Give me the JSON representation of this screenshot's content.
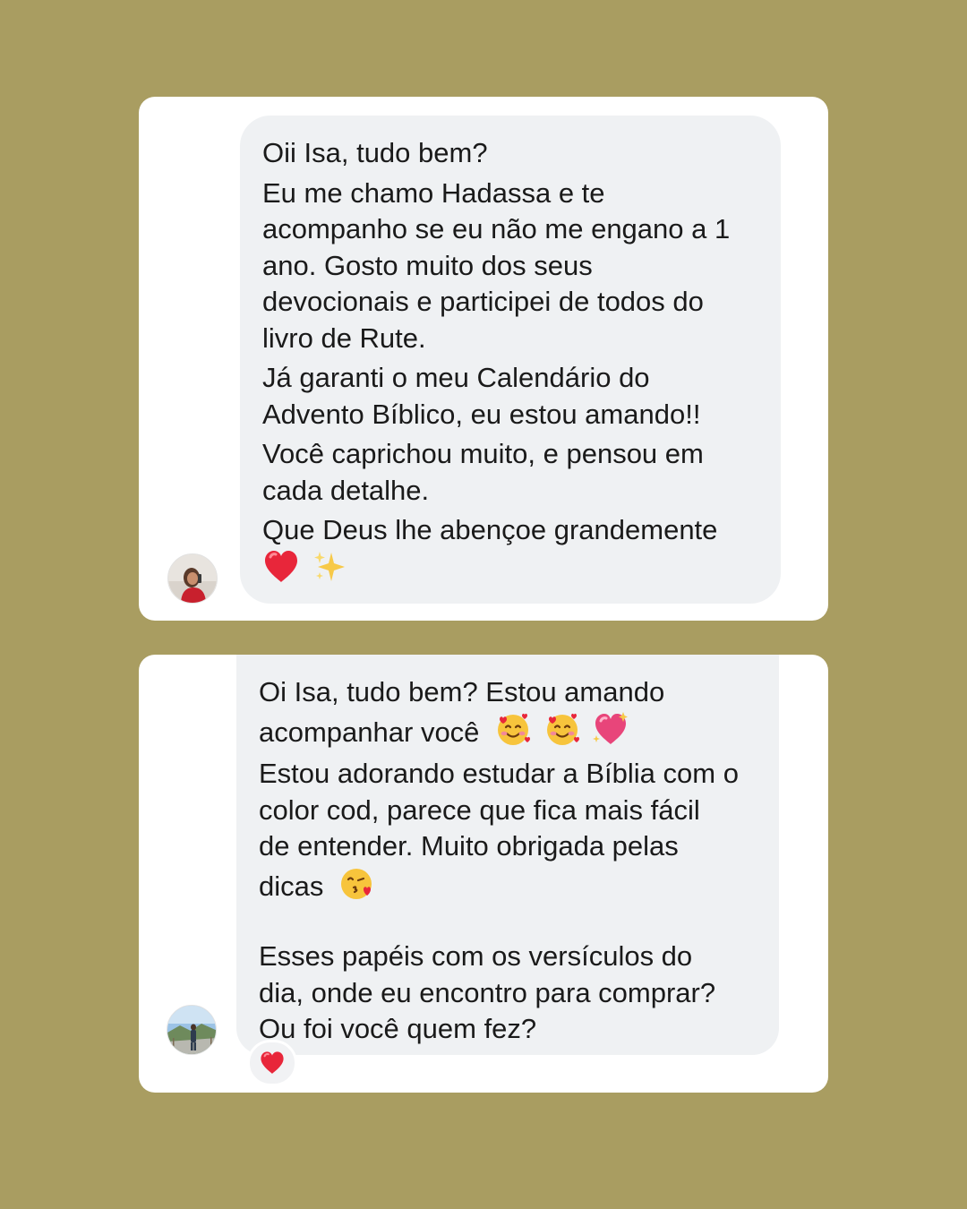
{
  "messages": [
    {
      "paragraphs": [
        [
          "Oii Isa, tudo bem?"
        ],
        [
          "Eu me chamo Hadassa e te",
          "acompanho se eu não me engano a 1",
          "ano. Gosto muito dos seus",
          "devocionais e participei de todos do",
          "livro de Rute."
        ],
        [
          "Já garanti o meu Calendário do",
          "Advento Bíblico, eu estou amando!!"
        ],
        [
          "Você caprichou muito, e pensou em",
          "cada detalhe."
        ],
        [
          "Que Deus lhe abençoe grandemente"
        ]
      ],
      "trailing_emojis": [
        "red-heart",
        "sparkles"
      ],
      "avatar": "profile-photo-woman-red-dress"
    },
    {
      "lines": [
        "Oi Isa, tudo bem? Estou amando",
        "acompanhar você",
        "Estou adorando estudar a Bíblia com o",
        "color cod, parece que fica mais fácil",
        "de entender. Muito obrigada pelas",
        "dicas"
      ],
      "line2_emojis": [
        "smiling-face-with-hearts",
        "smiling-face-with-hearts",
        "sparkling-heart"
      ],
      "line6_emoji": "face-blowing-kiss",
      "lines_after_gap": [
        "Esses papéis com os versículos do",
        "dia, onde eu encontro para comprar?",
        "Ou foi você quem fez?"
      ],
      "reaction": "red-heart",
      "avatar": "profile-photo-landscape"
    }
  ],
  "colors": {
    "background": "#a99d61",
    "card": "#ffffff",
    "bubble": "#eff1f3",
    "text": "#1a1a1a",
    "heart": "#e8263a"
  }
}
